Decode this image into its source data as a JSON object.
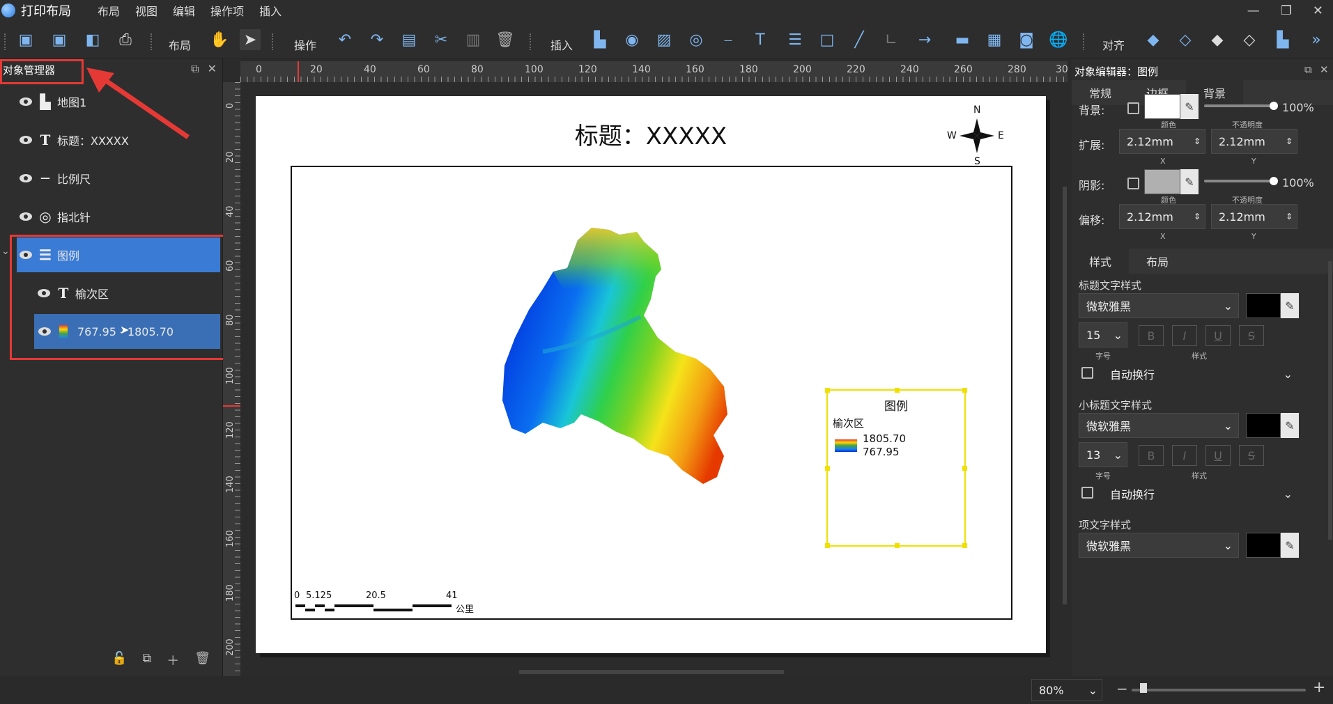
{
  "app": {
    "title": "打印布局"
  },
  "menu": [
    "布局",
    "视图",
    "编辑",
    "操作项",
    "插入"
  ],
  "toolbar": {
    "group_layout": "布局",
    "group_ops": "操作",
    "group_insert": "插入",
    "group_align": "对齐"
  },
  "object_manager": {
    "title": "对象管理器",
    "items": [
      {
        "label": "地图1",
        "icon": "map-icon"
      },
      {
        "label": "标题：XXXXX",
        "icon": "text-icon"
      },
      {
        "label": "比例尺",
        "icon": "scalebar-icon"
      },
      {
        "label": "指北针",
        "icon": "compass-icon"
      },
      {
        "label": "图例",
        "icon": "legend-icon",
        "selected": true
      },
      {
        "label": "榆次区",
        "icon": "text-icon"
      },
      {
        "label": "767.95 - 1805.70",
        "icon": "color-ramp-icon",
        "selected": true
      }
    ]
  },
  "ruler": {
    "top": [
      "0",
      "20",
      "40",
      "60",
      "80",
      "100",
      "120",
      "140",
      "160",
      "180",
      "200",
      "220",
      "240",
      "260",
      "280",
      "30"
    ],
    "left": [
      "0",
      "20",
      "40",
      "60",
      "80",
      "100",
      "120",
      "140",
      "160",
      "180",
      "200"
    ]
  },
  "map": {
    "title": "标题：XXXXX",
    "compass": {
      "n": "N",
      "s": "S",
      "e": "E",
      "w": "W"
    },
    "legend": {
      "title": "图例",
      "layer": "榆次区",
      "max": "1805.70",
      "min": "767.95"
    },
    "scalebar": {
      "t0": "0",
      "t1": "5.125",
      "t2": "20.5",
      "t3": "41",
      "unit": "公里"
    }
  },
  "editor": {
    "title": "对象编辑器：图例",
    "tabs": [
      "常规",
      "边框",
      "背景"
    ],
    "background_label": "背景:",
    "color_caption": "颜色",
    "opacity_caption": "不透明度",
    "bg_opacity": "100%",
    "expand_label": "扩展:",
    "expand_x": "2.12mm",
    "expand_y": "2.12mm",
    "x_caption": "X",
    "y_caption": "Y",
    "shadow_label": "阴影:",
    "shadow_opacity": "100%",
    "offset_label": "偏移:",
    "offset_x": "2.12mm",
    "offset_y": "2.12mm",
    "style_tabs": [
      "样式",
      "布局"
    ],
    "title_style_label": "标题文字样式",
    "title_font": "微软雅黑",
    "title_size": "15",
    "size_caption": "字号",
    "style_caption": "样式",
    "wrap_label": "自动换行",
    "subtitle_style_label": "小标题文字样式",
    "subtitle_font": "微软雅黑",
    "subtitle_size": "13",
    "item_style_label": "项文字样式",
    "item_font": "微软雅黑"
  },
  "status": {
    "zoom": "80%"
  },
  "colors": {
    "accent": "#3a7bd5",
    "highlight_red": "#e53935",
    "selection_yellow": "#f0e000"
  }
}
